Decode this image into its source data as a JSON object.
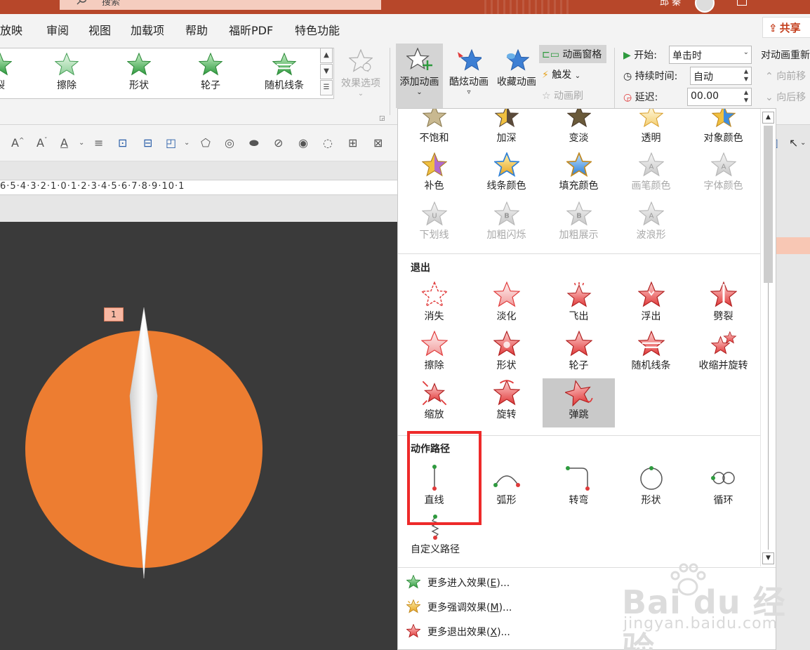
{
  "titlebar": {
    "search_text": "搜索",
    "user_name": "邱 秦"
  },
  "menu": {
    "items": [
      "放映",
      "审阅",
      "视图",
      "加载项",
      "帮助",
      "福昕PDF",
      "特色功能"
    ],
    "share": "共享"
  },
  "ribbon": {
    "gallery": [
      "裂",
      "擦除",
      "形状",
      "轮子",
      "随机线条"
    ],
    "effect_options": "效果选项",
    "add_animation": "添加动画",
    "cool_animation": "酷炫动画",
    "fav_animation": "收藏动画",
    "animation_pane": "动画窗格",
    "trigger": "触发",
    "animation_painter": "动画刷",
    "start_label": "开始:",
    "start_value": "单击时",
    "duration_label": "持续时间:",
    "duration_value": "自动",
    "delay_label": "延迟:",
    "delay_value": "00.00",
    "reorder_label": "对动画重新",
    "move_earlier": "向前移",
    "move_later": "向后移"
  },
  "ruler": "6·5·4·3·2·1·0·1·2·3·4·5·6·7·8·9·10·1",
  "canvas": {
    "anim_badge": "1"
  },
  "dropdown": {
    "emphasis_row1": [
      "不饱和",
      "加深",
      "变淡",
      "透明",
      "对象颜色"
    ],
    "emphasis_row2": [
      "补色",
      "线条颜色",
      "填充颜色",
      "画笔颜色",
      "字体颜色"
    ],
    "emphasis_row3": [
      "下划线",
      "加粗闪烁",
      "加粗展示",
      "波浪形"
    ],
    "exit_title": "退出",
    "exit_row1": [
      "消失",
      "淡化",
      "飞出",
      "浮出",
      "劈裂"
    ],
    "exit_row2": [
      "擦除",
      "形状",
      "轮子",
      "随机线条",
      "收缩并旋转"
    ],
    "exit_row3": [
      "缩放",
      "旋转",
      "弹跳"
    ],
    "path_title": "动作路径",
    "paths": [
      "直线",
      "弧形",
      "转弯",
      "形状",
      "循环"
    ],
    "custom_path": "自定义路径",
    "more": [
      {
        "text": "更多进入效果(",
        "key": "E",
        "tail": ")..."
      },
      {
        "text": "更多强调效果(",
        "key": "M",
        "tail": ")..."
      },
      {
        "text": "更多退出效果(",
        "key": "X",
        "tail": ")..."
      }
    ]
  },
  "colors": {
    "accent": "#b7472a",
    "orange": "#ed7d31",
    "highlight_box": "#ee2a2a"
  },
  "watermark": {
    "brand": "Bai du 经验",
    "url": "jingyan.baidu.com"
  }
}
